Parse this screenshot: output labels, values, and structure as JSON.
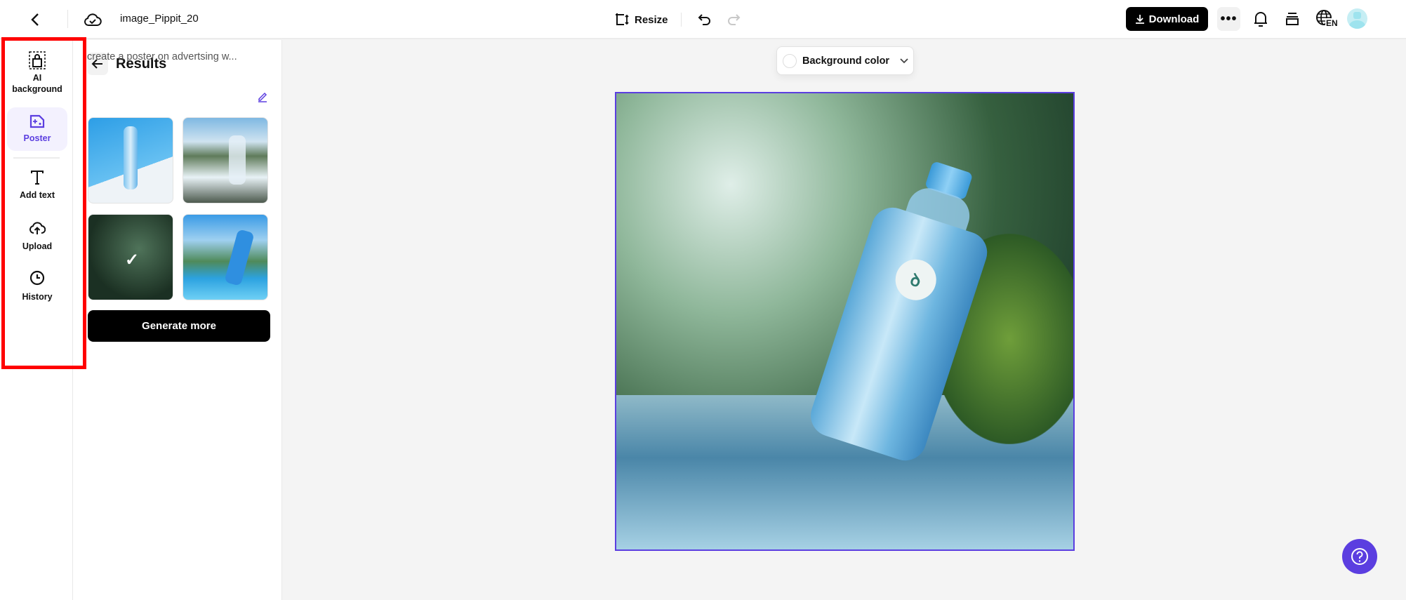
{
  "header": {
    "title": "image_Pippit_20",
    "resize_label": "Resize",
    "download_label": "Download",
    "language": "EN"
  },
  "rail": {
    "items": [
      {
        "label": "AI background"
      },
      {
        "label": "Poster",
        "active": true
      },
      {
        "label": "Add text"
      },
      {
        "label": "Upload"
      },
      {
        "label": "History"
      }
    ]
  },
  "panel": {
    "title": "Results",
    "prompt": "create a poster on advertsing w...",
    "generate_label": "Generate more",
    "selected_index": 2
  },
  "canvas": {
    "bg_color_label": "Background color"
  },
  "colors": {
    "accent": "#5b3ee0",
    "highlight": "#ff0000",
    "download_bg": "#000000"
  }
}
